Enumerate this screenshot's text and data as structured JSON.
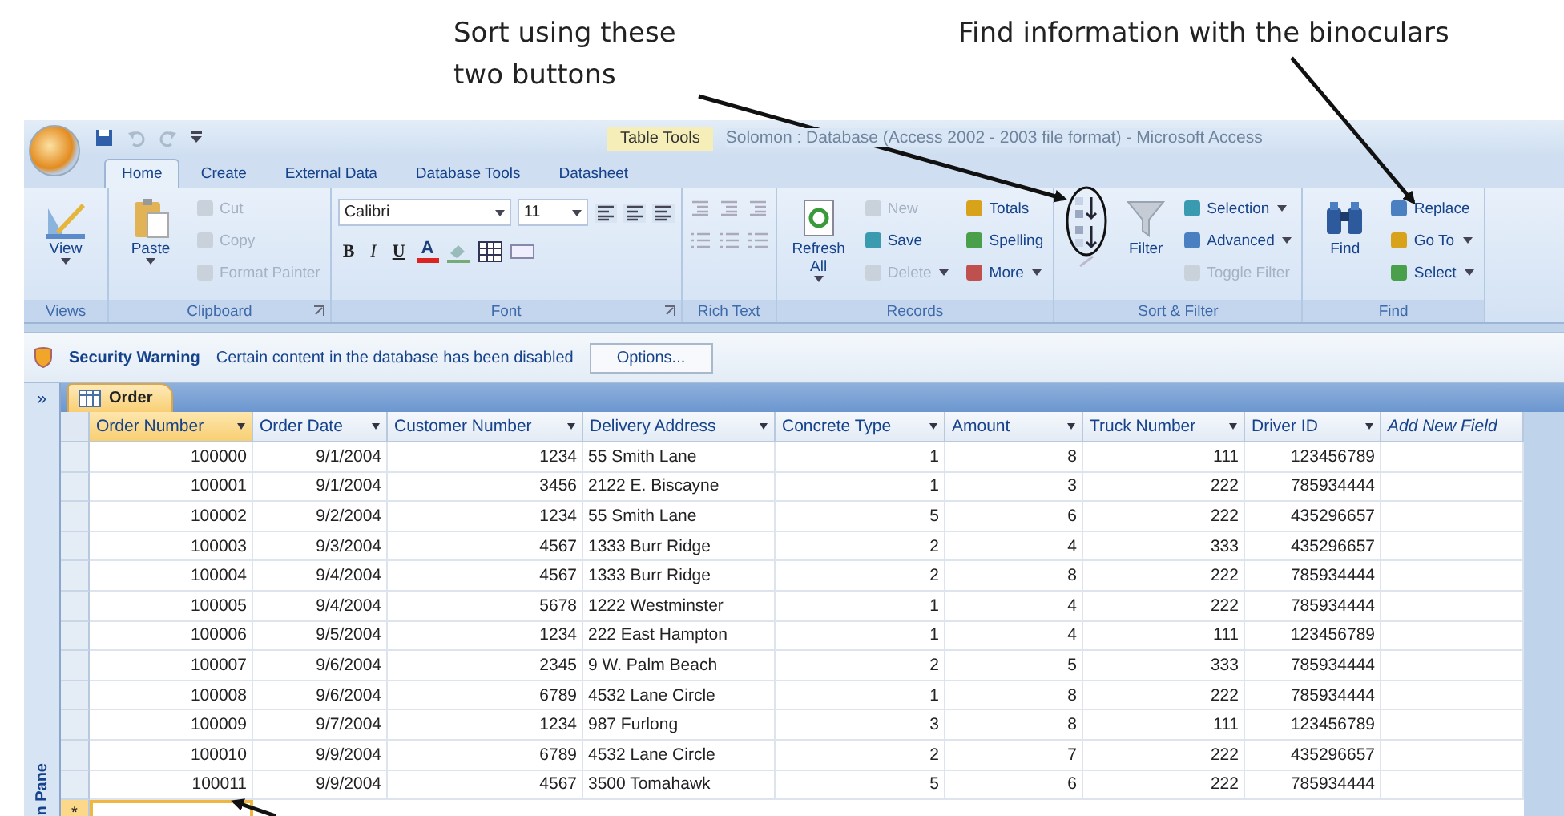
{
  "annotations": [
    {
      "text": "Sort using these two buttons"
    },
    {
      "text": "Find information with the binoculars"
    }
  ],
  "window": {
    "title": "Solomon : Database (Access 2002 - 2003 file format) - Microsoft Access",
    "context_tab": "Table Tools"
  },
  "ribbon_tabs": [
    {
      "label": "Home",
      "selected": true
    },
    {
      "label": "Create",
      "selected": false
    },
    {
      "label": "External Data",
      "selected": false
    },
    {
      "label": "Database Tools",
      "selected": false
    },
    {
      "label": "Datasheet",
      "selected": false
    }
  ],
  "ribbon_groups": [
    {
      "kind": "views",
      "label": "Views",
      "launcher": false,
      "items": [
        {
          "kind": "large",
          "label": "View",
          "dropdown": true,
          "disabled": false
        }
      ]
    },
    {
      "kind": "clipboard",
      "label": "Clipboard",
      "launcher": true,
      "items": [
        {
          "kind": "large",
          "label": "Paste",
          "dropdown": true,
          "disabled": false
        },
        {
          "kind": "small",
          "label": "Cut",
          "dropdown": false,
          "disabled": true
        },
        {
          "kind": "small",
          "label": "Copy",
          "dropdown": false,
          "disabled": true
        },
        {
          "kind": "small",
          "label": "Format Painter",
          "dropdown": false,
          "disabled": true
        }
      ]
    },
    {
      "kind": "font",
      "label": "Font",
      "launcher": true,
      "items": [
        {
          "kind": "field",
          "value": "Calibri"
        },
        {
          "kind": "field",
          "value": "11"
        },
        {
          "kind": "glyph",
          "label": "B"
        },
        {
          "kind": "glyph",
          "label": "I"
        },
        {
          "kind": "glyph",
          "label": "U"
        },
        {
          "kind": "glyph",
          "label": "A"
        }
      ]
    },
    {
      "kind": "rich_text",
      "label": "Rich Text",
      "launcher": false
    },
    {
      "kind": "records",
      "label": "Records",
      "launcher": false,
      "items": [
        {
          "kind": "large",
          "label": "Refresh All",
          "dropdown": true,
          "disabled": false
        },
        {
          "kind": "small",
          "label": "New",
          "dropdown": false,
          "disabled": true
        },
        {
          "kind": "small",
          "label": "Save",
          "dropdown": false,
          "disabled": false
        },
        {
          "kind": "small",
          "label": "Delete",
          "dropdown": true,
          "disabled": true
        },
        {
          "kind": "small",
          "label": "Totals",
          "dropdown": false,
          "disabled": false
        },
        {
          "kind": "small",
          "label": "Spelling",
          "dropdown": false,
          "disabled": false
        },
        {
          "kind": "small",
          "label": "More",
          "dropdown": true,
          "disabled": false
        }
      ]
    },
    {
      "kind": "sort_filter",
      "label": "Sort & Filter",
      "launcher": false,
      "items": [
        {
          "kind": "large",
          "label": "Filter",
          "dropdown": false,
          "disabled": false
        },
        {
          "kind": "small",
          "label": "Selection",
          "dropdown": true,
          "disabled": false
        },
        {
          "kind": "small",
          "label": "Advanced",
          "dropdown": true,
          "disabled": false
        },
        {
          "kind": "small",
          "label": "Toggle Filter",
          "dropdown": false,
          "disabled": true
        }
      ]
    },
    {
      "kind": "find",
      "label": "Find",
      "launcher": false,
      "items": [
        {
          "kind": "large",
          "label": "Find",
          "dropdown": false,
          "disabled": false
        },
        {
          "kind": "small",
          "label": "Replace",
          "dropdown": false,
          "disabled": false
        },
        {
          "kind": "small",
          "label": "Go To",
          "dropdown": true,
          "disabled": false
        },
        {
          "kind": "small",
          "label": "Select",
          "dropdown": true,
          "disabled": false
        }
      ]
    }
  ],
  "security_bar": {
    "title": "Security Warning",
    "message": "Certain content in the database has been disabled",
    "button": "Options..."
  },
  "navigation_pane": {
    "toggle": "»",
    "label": "n Pane"
  },
  "document_tabs": [
    {
      "label": "Order",
      "selected": true
    }
  ],
  "table": {
    "columns": [
      {
        "label": "Order Number",
        "kind": "number",
        "selected": true
      },
      {
        "label": "Order Date",
        "kind": "number",
        "selected": false
      },
      {
        "label": "Customer Number",
        "kind": "number",
        "selected": false
      },
      {
        "label": "Delivery Address",
        "kind": "text",
        "selected": false
      },
      {
        "label": "Concrete Type",
        "kind": "number",
        "selected": false
      },
      {
        "label": "Amount",
        "kind": "number",
        "selected": false
      },
      {
        "label": "Truck Number",
        "kind": "number",
        "selected": false
      },
      {
        "label": "Driver ID",
        "kind": "number",
        "selected": false
      },
      {
        "label": "Add New Field",
        "kind": "add",
        "selected": false
      }
    ],
    "rows": [
      [
        "100000",
        "9/1/2004",
        "1234",
        "55 Smith Lane",
        "1",
        "8",
        "111",
        "123456789"
      ],
      [
        "100001",
        "9/1/2004",
        "3456",
        "2122 E. Biscayne",
        "1",
        "3",
        "222",
        "785934444"
      ],
      [
        "100002",
        "9/2/2004",
        "1234",
        "55 Smith Lane",
        "5",
        "6",
        "222",
        "435296657"
      ],
      [
        "100003",
        "9/3/2004",
        "4567",
        "1333 Burr Ridge",
        "2",
        "4",
        "333",
        "435296657"
      ],
      [
        "100004",
        "9/4/2004",
        "4567",
        "1333 Burr Ridge",
        "2",
        "8",
        "222",
        "785934444"
      ],
      [
        "100005",
        "9/4/2004",
        "5678",
        "1222 Westminster",
        "1",
        "4",
        "222",
        "785934444"
      ],
      [
        "100006",
        "9/5/2004",
        "1234",
        "222 East Hampton",
        "1",
        "4",
        "111",
        "123456789"
      ],
      [
        "100007",
        "9/6/2004",
        "2345",
        "9 W. Palm Beach",
        "2",
        "5",
        "333",
        "785934444"
      ],
      [
        "100008",
        "9/6/2004",
        "6789",
        "4532 Lane Circle",
        "1",
        "8",
        "222",
        "785934444"
      ],
      [
        "100009",
        "9/7/2004",
        "1234",
        "987 Furlong",
        "3",
        "8",
        "111",
        "123456789"
      ],
      [
        "100010",
        "9/9/2004",
        "6789",
        "4532 Lane Circle",
        "2",
        "7",
        "222",
        "435296657"
      ],
      [
        "100011",
        "9/9/2004",
        "4567",
        "3500 Tomahawk",
        "5",
        "6",
        "222",
        "785934444"
      ]
    ],
    "new_row_marker": "*"
  }
}
